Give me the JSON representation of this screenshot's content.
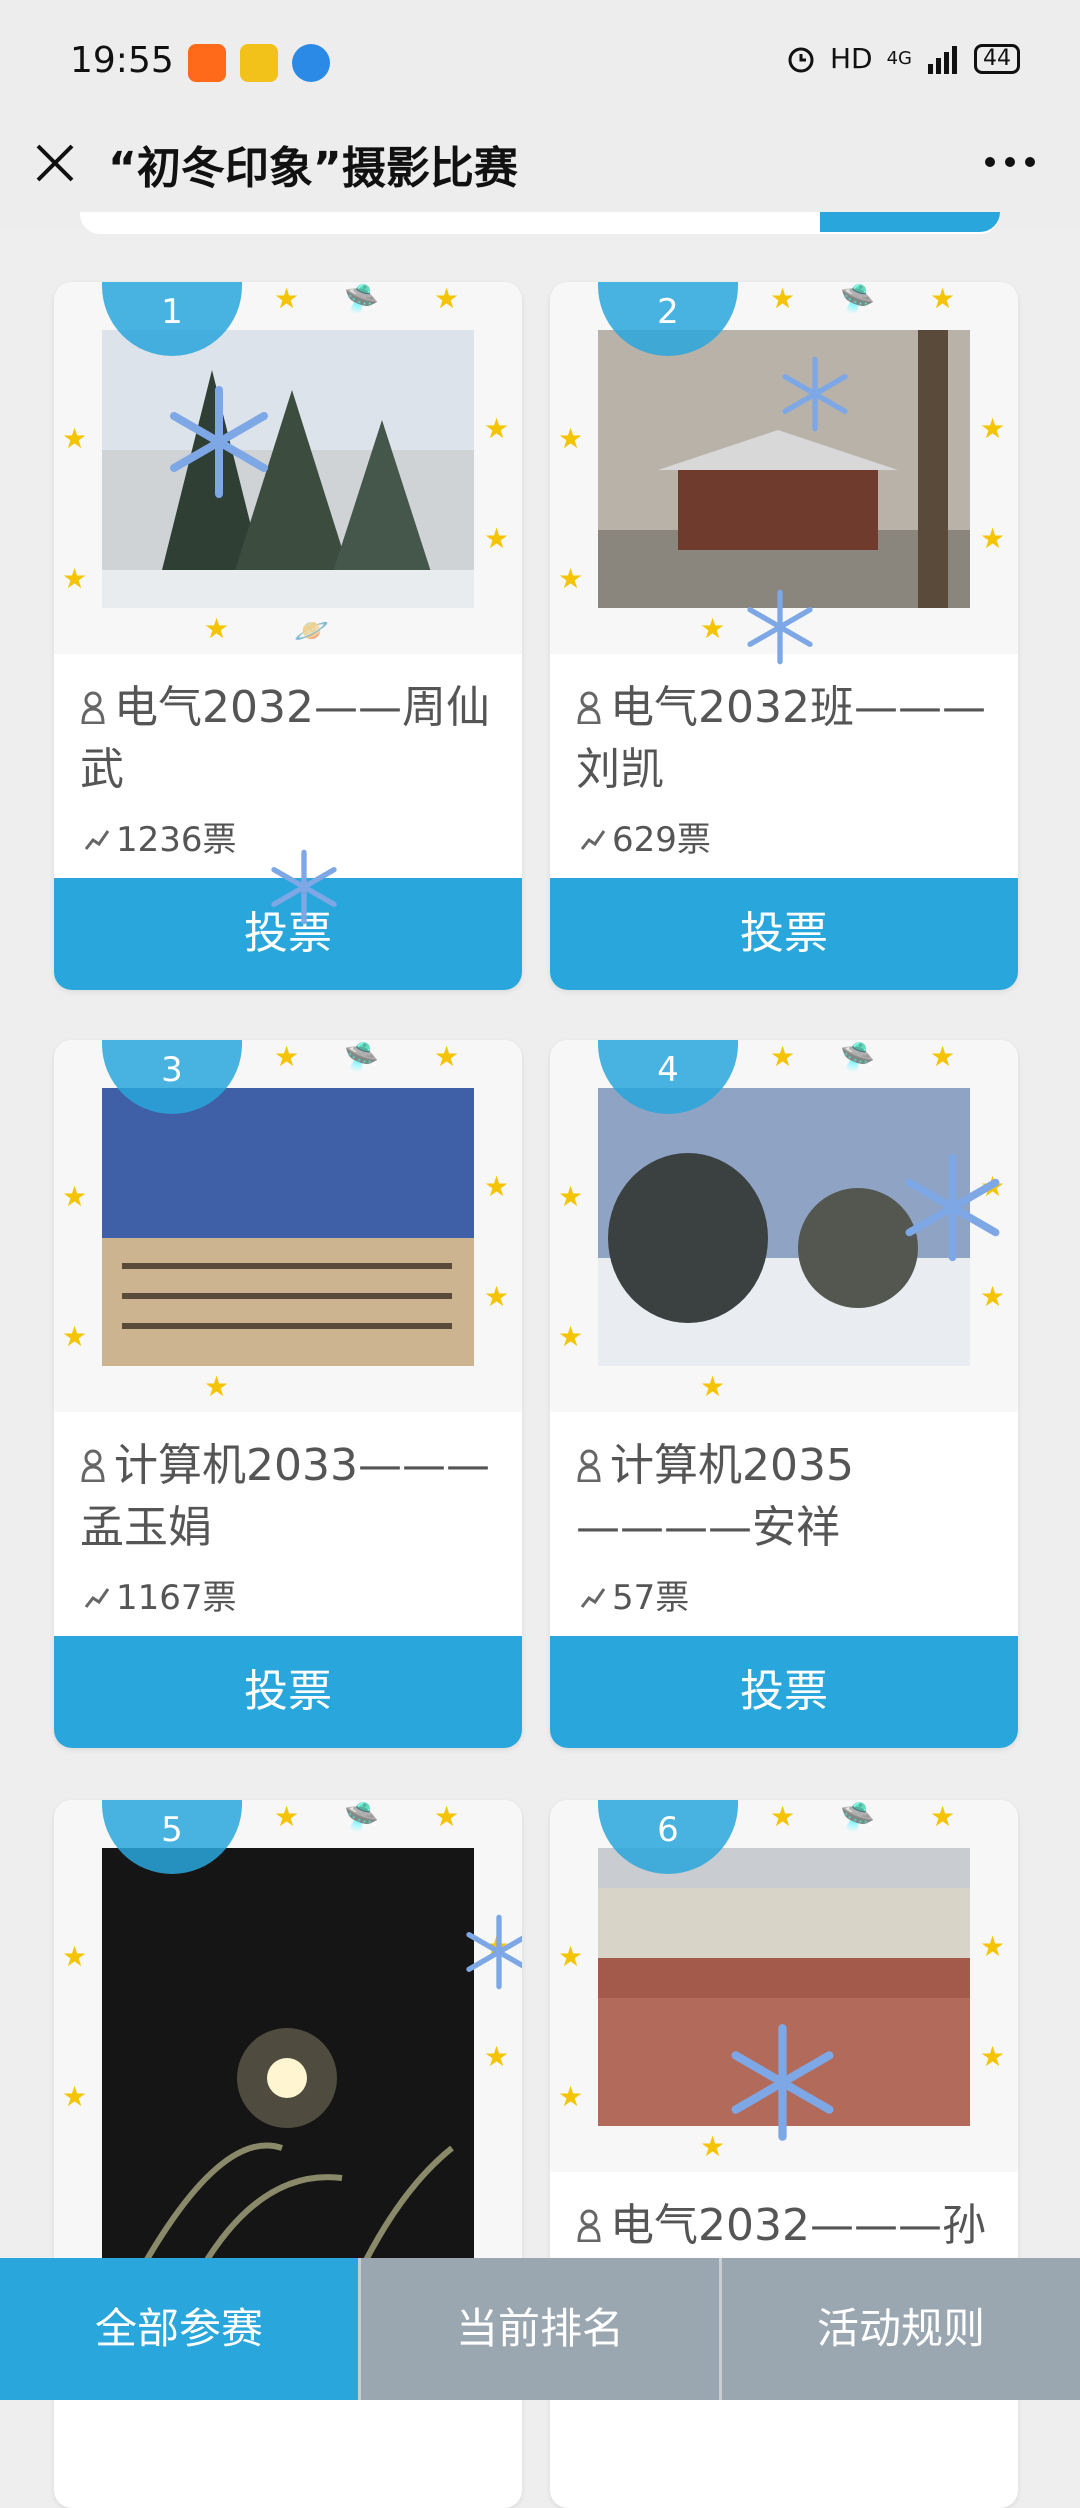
{
  "status_bar": {
    "time": "19:55",
    "network": "HD",
    "signal": "4G",
    "battery": "44"
  },
  "header": {
    "title": "“初冬印象”摄影比赛"
  },
  "entries": [
    {
      "rank": "1",
      "name": "电气2032——周仙武",
      "votes": "1236票",
      "button": "投票"
    },
    {
      "rank": "2",
      "name": "电气2032班———刘凯",
      "votes": "629票",
      "button": "投票"
    },
    {
      "rank": "3",
      "name": "计算机2033———孟玉娟",
      "votes": "1167票",
      "button": "投票"
    },
    {
      "rank": "4",
      "name": "计算机2035————安祥",
      "votes": "57票",
      "button": "投票"
    },
    {
      "rank": "5",
      "name": "",
      "votes": "",
      "button": ""
    },
    {
      "rank": "6",
      "name": "电气2032———孙",
      "votes": "",
      "button": ""
    }
  ],
  "bottom_nav": {
    "tabs": [
      {
        "label": "全部参赛",
        "active": true
      },
      {
        "label": "当前排名",
        "active": false
      },
      {
        "label": "活动规则",
        "active": false
      }
    ]
  },
  "colors": {
    "accent": "#29a6dc",
    "nav_inactive": "#9aa7b0"
  }
}
